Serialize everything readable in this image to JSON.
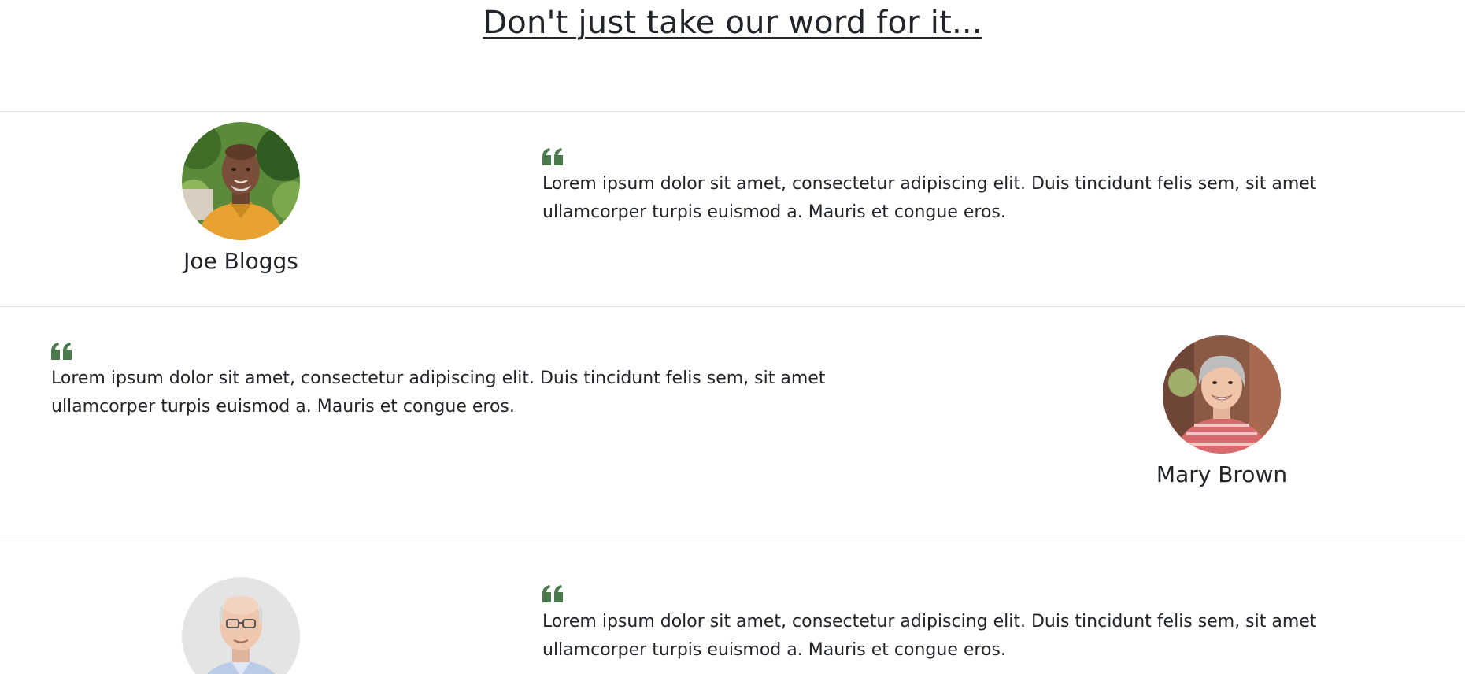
{
  "heading": "Don't just take our word for it...",
  "accent_color": "#4a7a4c",
  "testimonials": [
    {
      "name": "Joe Bloggs",
      "quote": "Lorem ipsum dolor sit amet, consectetur adipiscing elit. Duis tincidunt felis sem, sit amet ullamcorper turpis euismod a. Mauris et congue eros.",
      "quote_icon": "quote-left-icon",
      "photo": "avatar-photo"
    },
    {
      "name": "Mary Brown",
      "quote": "Lorem ipsum dolor sit amet, consectetur adipiscing elit. Duis tincidunt felis sem, sit amet ullamcorper turpis euismod a. Mauris et congue eros.",
      "quote_icon": "quote-left-icon",
      "photo": "avatar-photo"
    },
    {
      "name": "",
      "quote": "Lorem ipsum dolor sit amet, consectetur adipiscing elit. Duis tincidunt felis sem, sit amet ullamcorper turpis euismod a. Mauris et congue eros.",
      "quote_icon": "quote-left-icon",
      "photo": "avatar-photo"
    }
  ]
}
